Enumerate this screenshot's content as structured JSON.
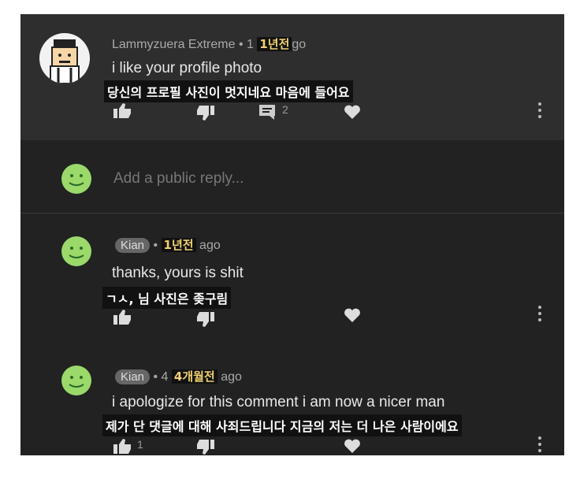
{
  "comments": [
    {
      "author": "Lammyzuera Extreme",
      "time_prefix": "• 1",
      "time_ko": "1년전",
      "time_suffix": "go",
      "text": "i like your profile photo",
      "translation": "당신의 프로필 사진이 멋지네요 마음에 들어요",
      "reply_count": "2"
    },
    {
      "author": "Kian",
      "time_prefix": "•",
      "time_ko": "1년전",
      "time_suffix": "ago",
      "text": "thanks, yours is shit",
      "translation": "ㄱㅅ, 님 사진은 좆구림"
    },
    {
      "author": "Kian",
      "time_prefix": "• 4",
      "time_ko": "4개월전",
      "time_suffix": "ago",
      "text": "i apologize for this comment i am now a nicer man",
      "translation": "제가 단 댓글에 대해 사죄드립니다 지금의 저는 더 나은 사람이에요",
      "like_count": "1"
    }
  ],
  "reply_box": {
    "placeholder": "Add a public reply..."
  },
  "colors": {
    "background": "#222222",
    "header": "#2e2e2e",
    "avatar_green": "#9ad96a",
    "korean_time": "#f0d070"
  },
  "icons": [
    "thumbs-up-icon",
    "thumbs-down-icon",
    "reply-icon",
    "heart-icon",
    "more-vert-icon"
  ]
}
